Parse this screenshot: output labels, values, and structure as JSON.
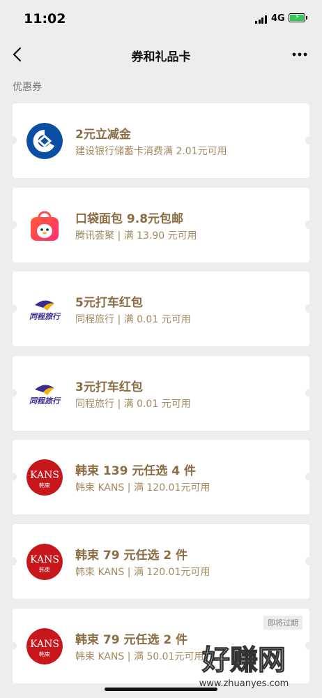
{
  "status": {
    "time": "11:02",
    "network": "4G"
  },
  "nav": {
    "title": "券和礼品卡"
  },
  "section": {
    "label": "优惠券"
  },
  "coupons": [
    {
      "title": "2元立减金",
      "subtitle": "建设银行储蓄卡消费满 2.01元可用",
      "logo": "ccb-bank-logo"
    },
    {
      "title": "口袋面包 9.8元包邮",
      "subtitle": "腾讯荟聚 | 满 13.90 元可用",
      "logo": "shopping-bag-penguin-logo"
    },
    {
      "title": "5元打车红包",
      "subtitle": "同程旅行 | 满 0.01 元可用",
      "logo": "tongcheng-travel-logo",
      "logo_text": "同程旅行"
    },
    {
      "title": "3元打车红包",
      "subtitle": "同程旅行 | 满 0.01 元可用",
      "logo": "tongcheng-travel-logo",
      "logo_text": "同程旅行"
    },
    {
      "title": "韩束 139 元任选 4 件",
      "subtitle": "韩束 KANS | 满 120.01元可用",
      "logo": "kans-logo",
      "logo_text": "KANS",
      "logo_sub": "韩束"
    },
    {
      "title": "韩束 79 元任选 2 件",
      "subtitle": "韩束 KANS | 满 120.01元可用",
      "logo": "kans-logo",
      "logo_text": "KANS",
      "logo_sub": "韩束"
    },
    {
      "title": "韩束 79 元任选 2 件",
      "subtitle": "韩束 KANS | 满 50.01元可用",
      "logo": "kans-logo",
      "logo_text": "KANS",
      "logo_sub": "韩束",
      "badge": "即将过期"
    }
  ],
  "watermark": {
    "text": "好赚网",
    "url": "www.zhuanyes.com"
  },
  "colors": {
    "title": "#8b6c43",
    "subtitle": "#a58a62",
    "background": "#ededed",
    "kans_red": "#c8161d",
    "ccb_blue": "#0a4fa3"
  }
}
